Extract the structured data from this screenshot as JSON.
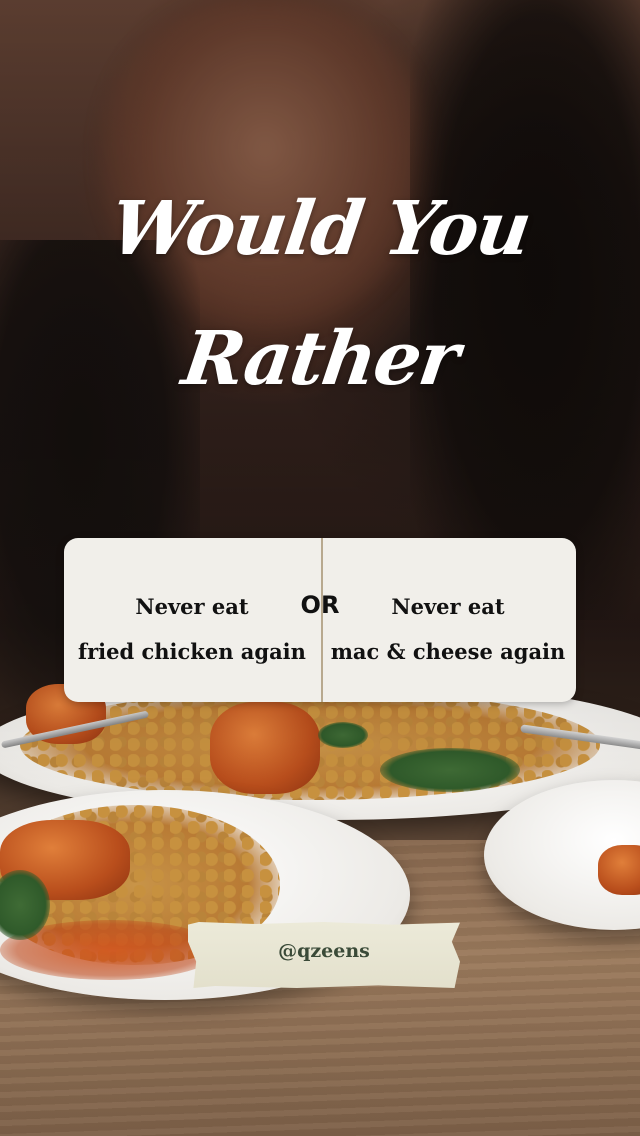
{
  "post": {
    "title_line1": "Would You",
    "title_line2": "Rather",
    "option_left": {
      "line1": "Never eat",
      "line2": "fried chicken again"
    },
    "separator": "OR",
    "option_right": {
      "line1": "Never eat",
      "line2": "mac & cheese again"
    },
    "handle": "@qzeens"
  },
  "colors": {
    "title": "#ffffff",
    "card_background": "#f1efea",
    "card_text": "#111111",
    "divider": "#b8a98f",
    "tape": "#e7e4d2",
    "handle_text": "#3a4a38"
  }
}
